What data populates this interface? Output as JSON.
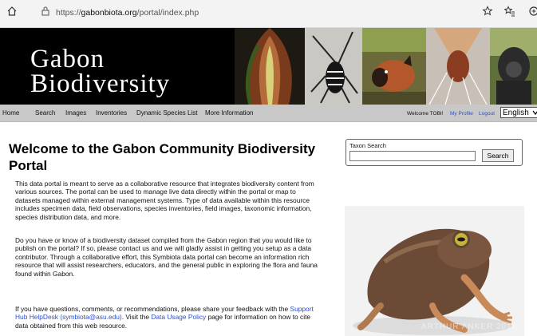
{
  "browser": {
    "url_prefix": "https://",
    "url_host": "gabonbiota.org",
    "url_path": "/portal/index.php"
  },
  "banner": {
    "title_line1": "Gabon",
    "title_line2": "Biodiversity"
  },
  "nav": {
    "items": [
      "Home",
      "Search",
      "Images",
      "Inventories",
      "Dynamic Species List",
      "More Information"
    ],
    "welcome": "Welcome TOBI!",
    "my_profile": "My Profile",
    "logout": "Logout",
    "language": "English"
  },
  "main": {
    "heading": "Welcome to the Gabon Community Biodiversity Portal",
    "p1": "This data portal is meant to serve as a collaborative resource that integrates biodiversity content from various sources. The portal can be used to manage live data directly within the portal or map to datasets managed within external management systems. Type of data available within this resource includes specimen data, field observations, species inventories, field images, taxonomic information, species distribution data, and more.",
    "p2": "Do you have or know of a biodiversity dataset compiled from the Gabon region that you would like to publish on the portal? If so, please contact us and we will gladly assist in getting you setup as a data contributor. Through a collaborative effort, this Symbiota data portal can become an information rich resource that will assist researchers, educators, and the general public in exploring the flora and fauna found within Gabon.",
    "p3_before": "If you have questions, comments, or recommendations, please share your feedback with the ",
    "p3_link1": "Support Hub HelpDesk (symbiota@asu.edu)",
    "p3_mid": ". Visit the ",
    "p3_link2": "Data Usage Policy",
    "p3_after": " page for information on how to cite data obtained from this web resource."
  },
  "taxon_search": {
    "label": "Taxon Search",
    "input_value": "",
    "button": "Search"
  },
  "photo_watermark": "ARTHUR ANKER 2016"
}
